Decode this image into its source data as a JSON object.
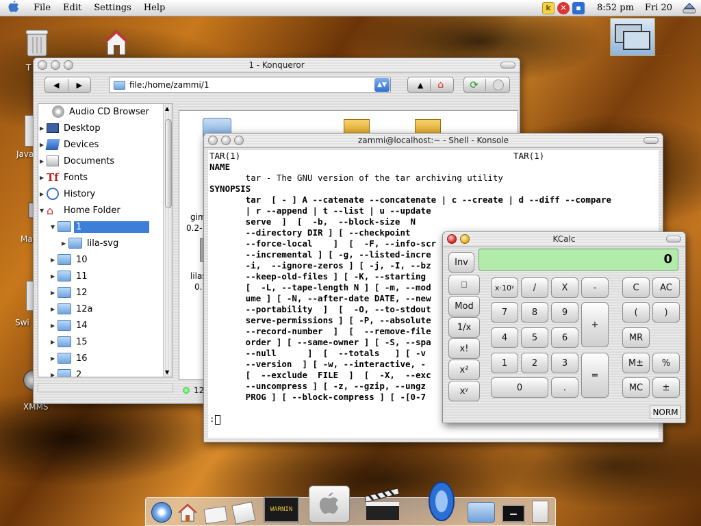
{
  "menubar": {
    "items": [
      "File",
      "Edit",
      "Settings",
      "Help"
    ],
    "clock": "8:52 pm",
    "date": "Fri 20"
  },
  "desktop": {
    "icons": [
      {
        "label": "T",
        "icon": "trash-icon"
      },
      {
        "label": "Java",
        "icon": "document-icon"
      },
      {
        "label": "Ma",
        "icon": "mail-icon"
      },
      {
        "label": "Swi",
        "icon": "document-icon"
      },
      {
        "label": "XMMS",
        "icon": "xmms-icon"
      }
    ]
  },
  "konqueror": {
    "title": "1 - Konqueror",
    "url": "file:/home/zammi/1",
    "tree": [
      {
        "label": "Audio CD Browser",
        "icon": "audio-cd-icon",
        "expandable": false
      },
      {
        "label": "Desktop",
        "icon": "desktop-icon",
        "expandable": true
      },
      {
        "label": "Devices",
        "icon": "devices-icon",
        "expandable": true
      },
      {
        "label": "Documents",
        "icon": "documents-icon",
        "expandable": true
      },
      {
        "label": "Fonts",
        "icon": "fonts-icon",
        "expandable": true
      },
      {
        "label": "History",
        "icon": "history-icon",
        "expandable": true
      },
      {
        "label": "Home Folder",
        "icon": "home-folder-icon",
        "expanded": true
      },
      {
        "label": "1",
        "icon": "folder-icon",
        "selected": true
      },
      {
        "label": "lila-svg",
        "icon": "folder-icon"
      },
      {
        "label": "10",
        "icon": "folder-icon"
      },
      {
        "label": "11",
        "icon": "folder-icon"
      },
      {
        "label": "12",
        "icon": "folder-icon"
      },
      {
        "label": "12a",
        "icon": "folder-icon"
      },
      {
        "label": "14",
        "icon": "folder-icon"
      },
      {
        "label": "15",
        "icon": "folder-icon"
      },
      {
        "label": "16",
        "icon": "folder-icon"
      },
      {
        "label": "2",
        "icon": "folder-icon"
      }
    ],
    "file_labels": [
      "gim",
      "0.2-",
      "lilas",
      "0.7"
    ],
    "status_count": "12"
  },
  "konsole": {
    "title": "zammi@localhost:~ - Shell - Konsole",
    "lines": [
      "TAR(1)                                                     TAR(1)",
      "",
      "NAME",
      "       tar - The GNU version of the tar archiving utility",
      "",
      "SYNOPSIS",
      "       tar  [ - ] A --catenate --concatenate | c --create | d --diff --compare",
      "       | r --append | t --list | u --update",
      "       serve  ]  [  -b,  --block-size  N",
      "       --directory DIR ] [ --checkpoint",
      "       --force-local    ]  [  -F, --info-scr",
      "       --incremental ] [ -g, --listed-incre",
      "       -i,  --ignore-zeros ] [ -j, -I, --bz",
      "       --keep-old-files ] [ -K, --starting",
      "       [  -L, --tape-length N ] [ -m, --mod",
      "       ume ] [ -N, --after-date DATE, --new",
      "       --portability  ]  [  -O, --to-stdout",
      "       serve-permissions ] [ -P, --absolute",
      "       --record-number  ]  [  --remove-file",
      "       order ] [ --same-owner ] [ -S, --spa",
      "       --null      ]  [  --totals   ] [ -v",
      "       --version  ] [ -w, --interactive, -",
      "       [  --exclude  FILE  ]  [  -X,  --exc",
      "       --uncompress ] [ -z, --gzip, --ungz",
      "       PROG ] [ --block-compress ] [ -[0-7"
    ],
    "prompt": ":"
  },
  "kcalc": {
    "title": "KCalc",
    "display": "0",
    "mode": "NORM",
    "buttons": {
      "inv": "Inv",
      "hyp": "⎕",
      "mod": "Mod",
      "recip": "1/x",
      "fact": "x!",
      "square": "x²",
      "power": "xʸ",
      "exp": "x·10ʸ",
      "div": "/",
      "mul": "X",
      "sub": "-",
      "add": "+",
      "eq": "=",
      "d7": "7",
      "d8": "8",
      "d9": "9",
      "d4": "4",
      "d5": "5",
      "d6": "6",
      "d1": "1",
      "d2": "2",
      "d3": "3",
      "d0": "0",
      "dot": ".",
      "c": "C",
      "ac": "AC",
      "lparen": "(",
      "rparen": ")",
      "mr": "MR",
      "mpm": "M±",
      "pct": "%",
      "mc": "MC",
      "pm": "±"
    }
  },
  "dock": {
    "items": [
      "safari-icon",
      "home-icon",
      "mail-icon",
      "notes-icon",
      "console-icon",
      "apple-switch-icon",
      "clapper-icon",
      "speaker-icon",
      "folder-icon",
      "terminal-icon",
      "calculator-icon"
    ],
    "warning_text": "WARNIN"
  }
}
